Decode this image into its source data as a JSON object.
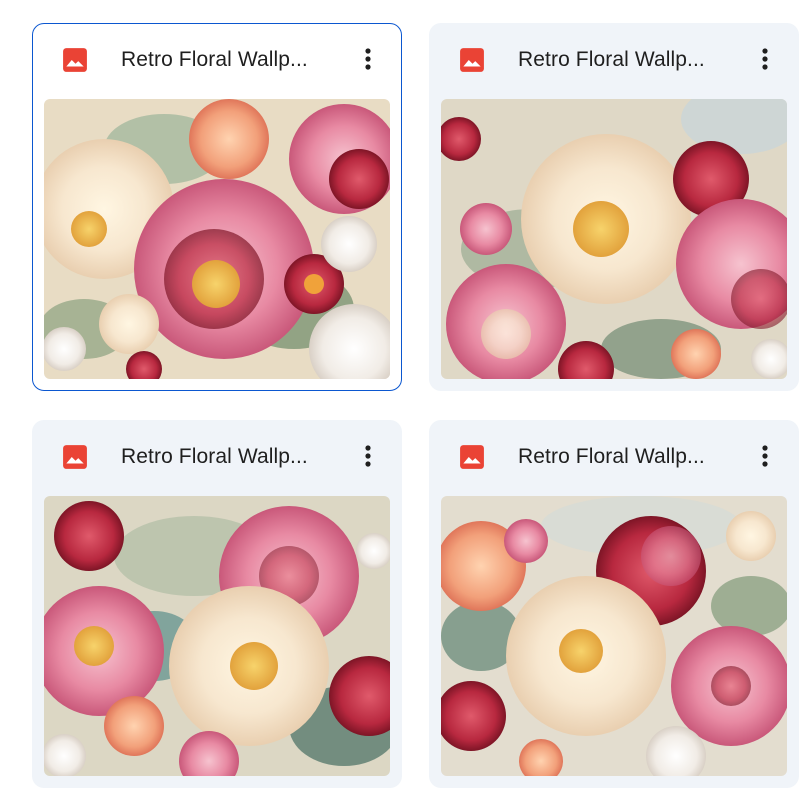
{
  "files": [
    {
      "title": "Retro Floral Wallp...",
      "type_icon": "image-icon",
      "selected": true
    },
    {
      "title": "Retro Floral Wallp...",
      "type_icon": "image-icon",
      "selected": false
    },
    {
      "title": "Retro Floral Wallp...",
      "type_icon": "image-icon",
      "selected": false
    },
    {
      "title": "Retro Floral Wallp...",
      "type_icon": "image-icon",
      "selected": false
    }
  ],
  "colors": {
    "selection_border": "#0b57d0",
    "card_background": "#f0f4f9",
    "image_icon_red": "#ea4335",
    "title_text": "#1f1f1f"
  },
  "icons": {
    "more_actions": "more-vert-icon"
  }
}
